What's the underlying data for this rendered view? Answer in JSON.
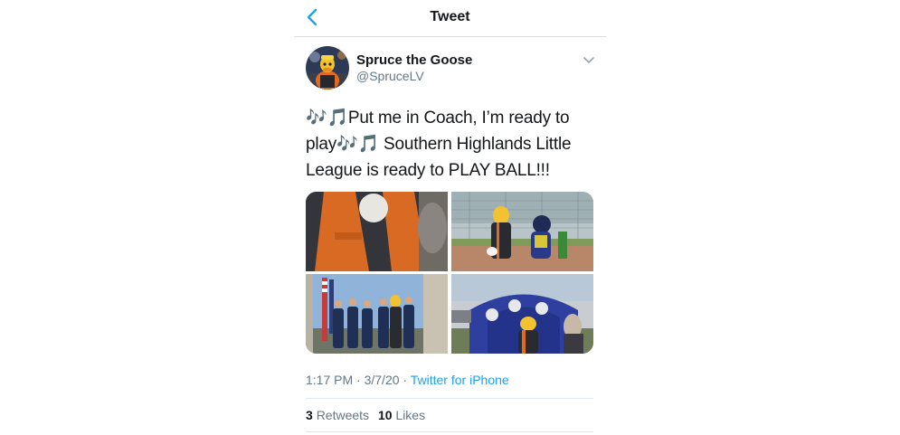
{
  "header": {
    "title": "Tweet",
    "back_icon": "chevron-left-icon",
    "accent_color": "#1da1f2"
  },
  "author": {
    "display_name": "Spruce the Goose",
    "handle": "@SpruceLV",
    "menu_icon": "chevron-down-icon"
  },
  "tweet": {
    "text": "🎶🎵Put me in Coach, I’m ready to play🎶🎵 Southern Highlands Little League is ready to PLAY BALL!!!"
  },
  "media": {
    "photos": [
      {
        "subject": "mascot-jersey-closeup"
      },
      {
        "subject": "mascots-on-field"
      },
      {
        "subject": "color-guard-group"
      },
      {
        "subject": "mascot-inflatable-tunnel"
      }
    ]
  },
  "meta": {
    "time": "1:17 PM",
    "separator": " · ",
    "date": "3/7/20",
    "source": "Twitter for iPhone"
  },
  "stats": {
    "retweets_count": "3",
    "retweets_label": "Retweets",
    "likes_count": "10",
    "likes_label": "Likes"
  }
}
